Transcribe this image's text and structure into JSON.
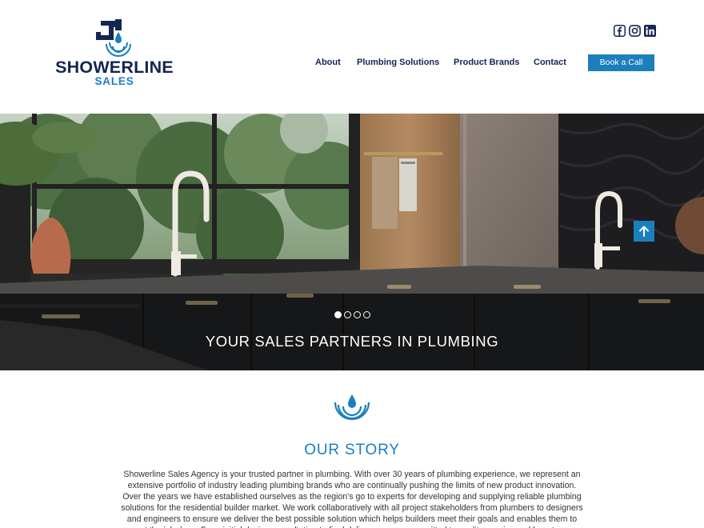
{
  "brand": {
    "name": "SHOWERLINE",
    "sub": "SALES",
    "navy": "#152552",
    "blue": "#1b7fbd"
  },
  "social": {
    "icons": [
      "facebook-icon",
      "instagram-icon",
      "linkedin-icon"
    ]
  },
  "nav": {
    "items": [
      {
        "label": "About"
      },
      {
        "label": "Plumbing Solutions"
      },
      {
        "label": "Product Brands"
      },
      {
        "label": "Contact"
      }
    ],
    "cta_label": "Book a Call"
  },
  "hero": {
    "caption": "YOUR SALES PARTNERS IN PLUMBING",
    "slides_total": 4,
    "active_slide": 1,
    "scroll_icon": "arrow-up-icon"
  },
  "story": {
    "title": "OUR STORY",
    "body": "Showerline Sales Agency is your trusted partner in plumbing.  With over 30 years of plumbing experience, we represent an extensive portfolio of industry leading plumbing brands who are continually pushing the limits of new product innovation. Over the years we have established ourselves as the region's go to experts for developing and supplying reliable plumbing solutions for the residential builder market. We work collaboratively with all project stakeholders from plumbers to designers and engineers to ensure we deliver the best possible solution which helps builders meet their goals and enables them to get the job done. From initial design consultation to final delivery, we are committed to quality, service and long-term partnerships."
  }
}
